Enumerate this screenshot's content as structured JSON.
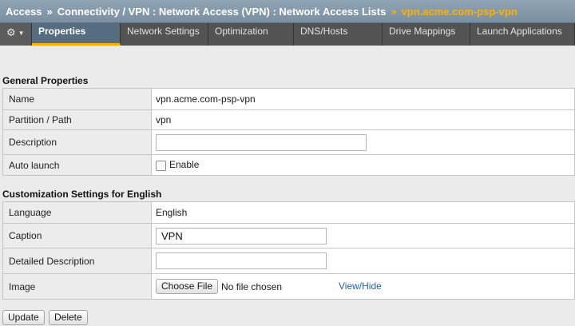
{
  "breadcrumb": {
    "items": [
      "Access",
      "Connectivity / VPN : Network Access (VPN) : Network Access Lists"
    ],
    "current": "vpn.acme.com-psp-vpn",
    "separator": "»"
  },
  "tabs": {
    "settings_icon": "gear-icon",
    "items": [
      "Properties",
      "Network Settings",
      "Optimization",
      "DNS/Hosts",
      "Drive Mappings",
      "Launch Applications"
    ],
    "active": "Properties"
  },
  "general": {
    "title": "General Properties",
    "name_label": "Name",
    "name_value": "vpn.acme.com-psp-vpn",
    "partition_label": "Partition / Path",
    "partition_value": "vpn",
    "description_label": "Description",
    "description_value": "",
    "autolaunch_label": "Auto launch",
    "autolaunch_option": "Enable",
    "autolaunch_checked": false
  },
  "customization": {
    "title": "Customization Settings for English",
    "language_label": "Language",
    "language_value": "English",
    "caption_label": "Caption",
    "caption_value": "VPN",
    "detailed_label": "Detailed Description",
    "detailed_value": "",
    "image_label": "Image",
    "choose_file": "Choose File",
    "no_file": "No file chosen",
    "view_hide": "View/Hide"
  },
  "actions": {
    "update": "Update",
    "delete": "Delete"
  },
  "colors": {
    "accent": "#ffb000",
    "tab_active": "#566c80",
    "header": "#7a90a1",
    "link": "#2b5fb4"
  }
}
